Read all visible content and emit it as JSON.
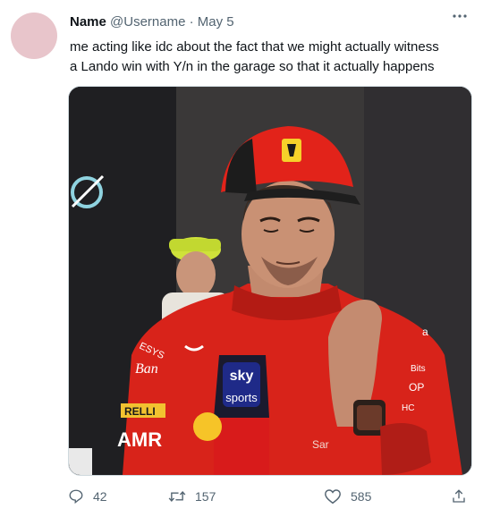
{
  "tweet": {
    "author_name": "Name",
    "handle": "@Username",
    "separator": "·",
    "date": "May 5",
    "text": "me acting like idc about the fact that we might actually witness\na Lando win with Y/n in the garage so that it actually happens",
    "media": {
      "mic_brand_top": "sky",
      "mic_brand_bottom": "sports",
      "suit_logo_left": "ESYS",
      "suit_logo_left2": "Ban",
      "suit_logo_pirelli": "RELLI",
      "suit_logo_amr": "AMR",
      "suit_logo_right_top": "a",
      "suit_logo_right_bits": "Bits",
      "suit_logo_right_op": "OP",
      "suit_logo_right_hc": "HC",
      "suit_logo_name": "Sar"
    },
    "stats": {
      "replies": "42",
      "retweets": "157",
      "likes": "585"
    }
  },
  "colors": {
    "text_primary": "#0f1419",
    "text_secondary": "#536471",
    "ferrari_red": "#e2231a",
    "border": "#cfd9de"
  }
}
